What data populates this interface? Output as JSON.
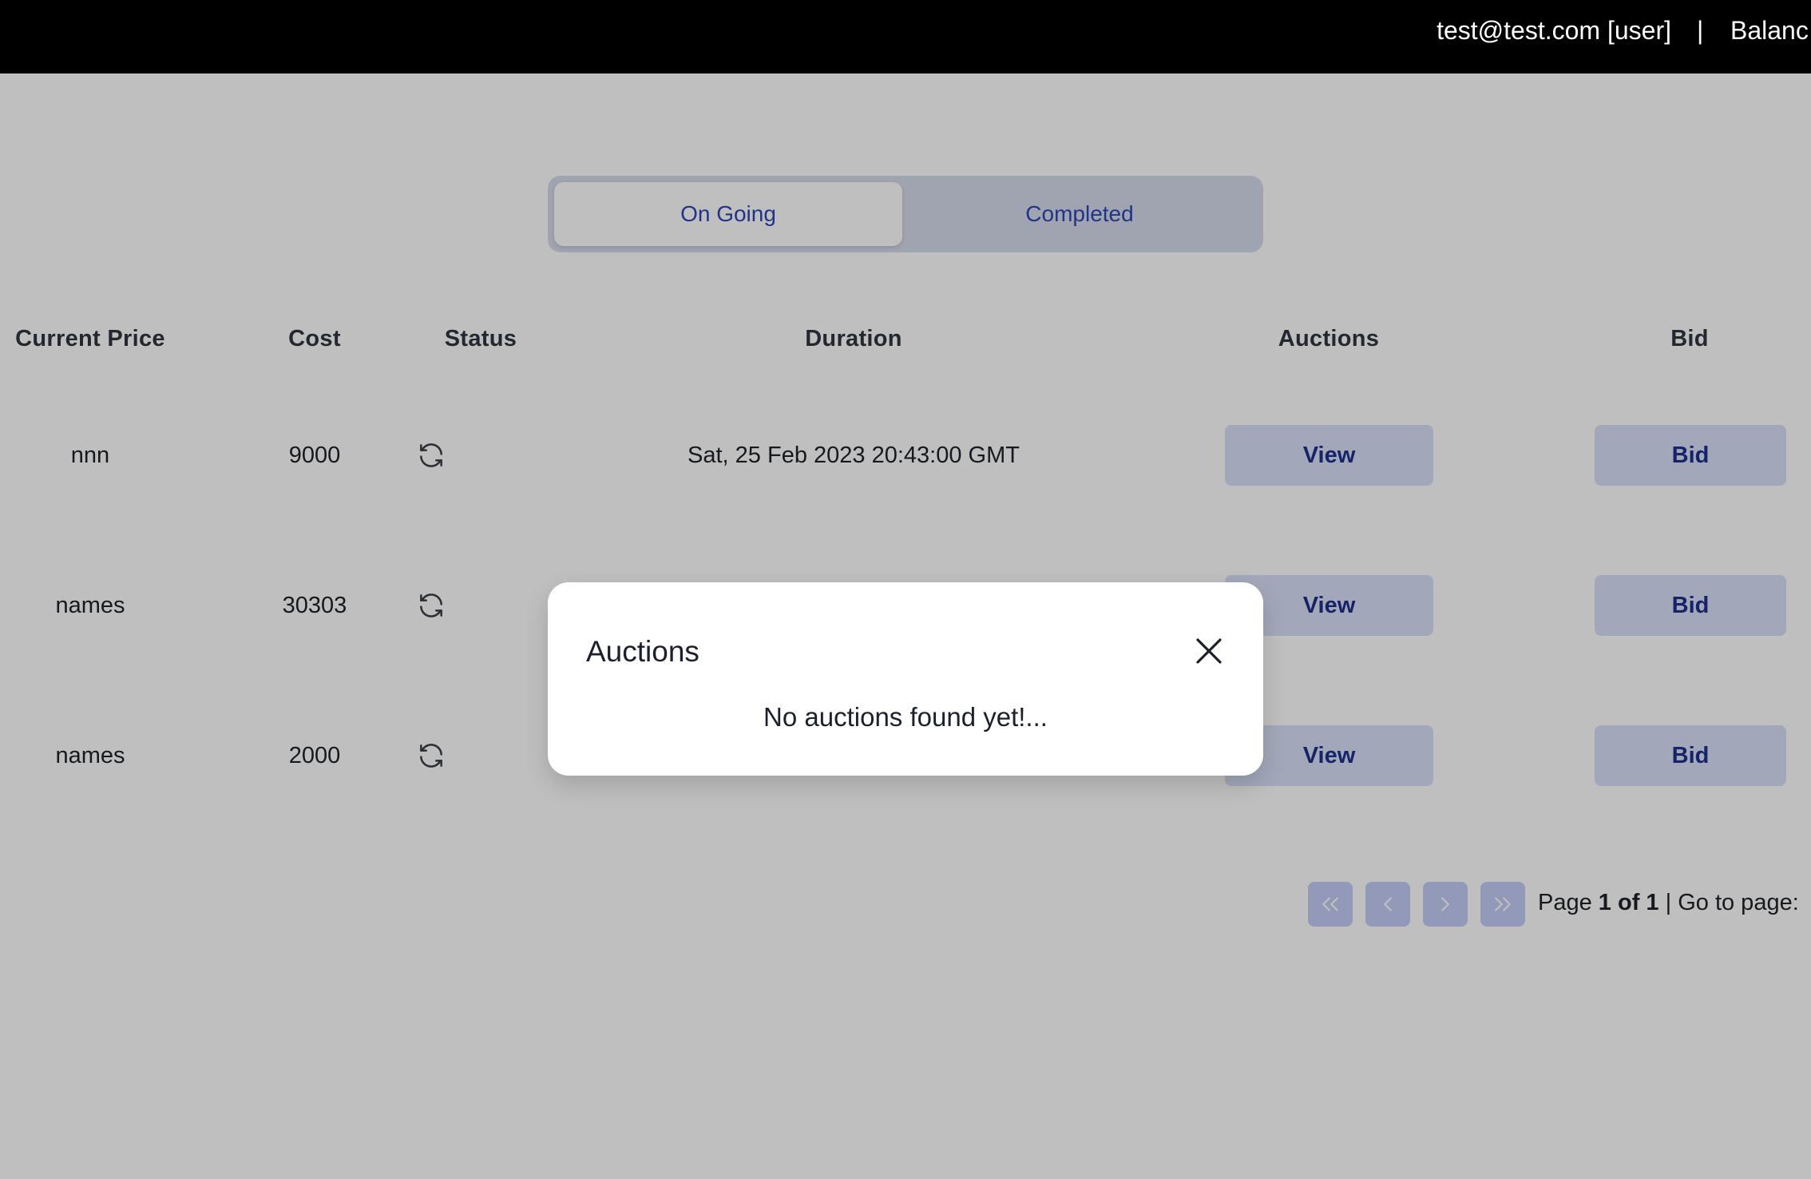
{
  "header": {
    "user": "test@test.com [user]",
    "separator": "|",
    "balance_label": "Balanc"
  },
  "tabs": {
    "ongoing": "On Going",
    "completed": "Completed",
    "active": "ongoing"
  },
  "table": {
    "columns": {
      "current_price": "Current Price",
      "cost": "Cost",
      "status": "Status",
      "duration": "Duration",
      "auctions": "Auctions",
      "bid": "Bid"
    },
    "rows": [
      {
        "current_price": "nnn",
        "cost": "9000",
        "status_icon": "refresh-icon",
        "duration": "Sat, 25 Feb 2023 20:43:00 GMT",
        "view_label": "View",
        "bid_label": "Bid"
      },
      {
        "current_price": "names",
        "cost": "30303",
        "status_icon": "refresh-icon",
        "duration": "",
        "view_label": "View",
        "bid_label": "Bid"
      },
      {
        "current_price": "names",
        "cost": "2000",
        "status_icon": "refresh-icon",
        "duration": "",
        "view_label": "View",
        "bid_label": "Bid"
      }
    ]
  },
  "pagination": {
    "first_icon": "chevrons-left-icon",
    "prev_icon": "chevron-left-icon",
    "next_icon": "chevron-right-icon",
    "last_icon": "chevrons-right-icon",
    "page_prefix": "Page",
    "page_value": "1 of 1",
    "goto_label": "| Go to page:"
  },
  "modal": {
    "title": "Auctions",
    "message": "No auctions found yet!...",
    "close_icon": "close-icon"
  },
  "colors": {
    "topbar": "#000000",
    "accent": "#2e46b8",
    "button_bg": "#d9e0f7",
    "button_text": "#1f2f8c",
    "pagination_bg": "#c3cdf7"
  }
}
